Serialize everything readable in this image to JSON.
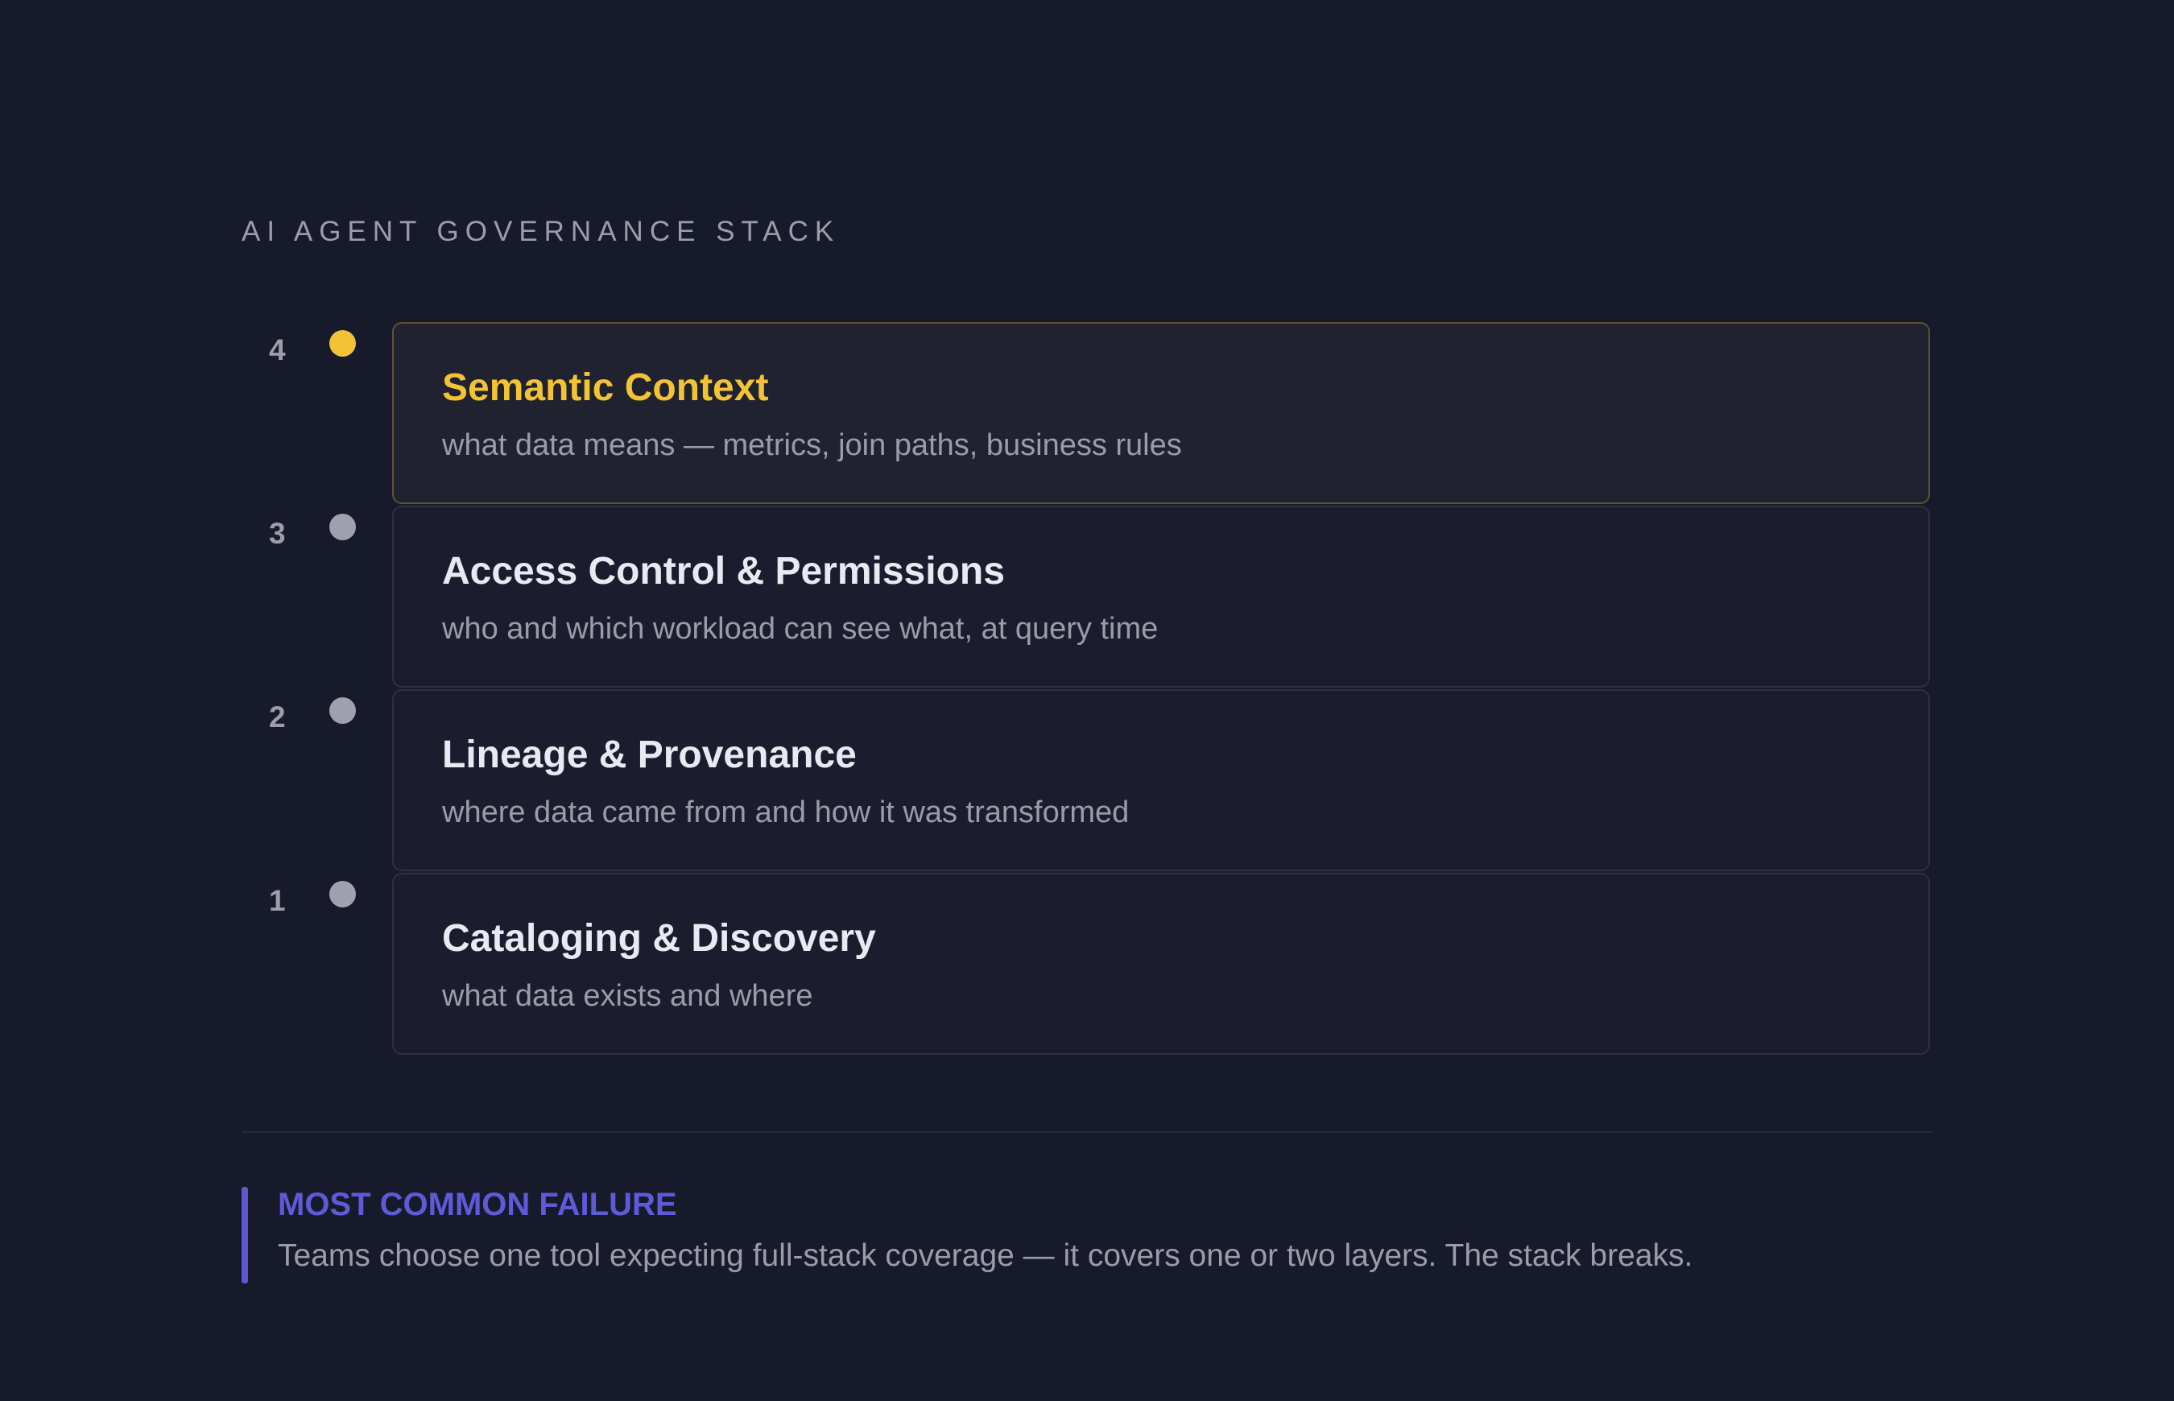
{
  "title": "AI AGENT GOVERNANCE STACK",
  "layers": [
    {
      "number": "4",
      "name": "Semantic Context",
      "description": "what data means — metrics, join paths, business rules",
      "highlighted": true
    },
    {
      "number": "3",
      "name": "Access Control & Permissions",
      "description": "who and which workload can see what, at query time",
      "highlighted": false
    },
    {
      "number": "2",
      "name": "Lineage & Provenance",
      "description": "where data came from and how it was transformed",
      "highlighted": false
    },
    {
      "number": "1",
      "name": "Cataloging & Discovery",
      "description": "what data exists and where",
      "highlighted": false
    }
  ],
  "callout": {
    "title": "MOST COMMON FAILURE",
    "text": "Teams choose one tool expecting full-stack coverage — it covers one or two layers. The stack breaks."
  },
  "colors": {
    "background": "#171a2b",
    "highlight": "#f2c335",
    "callout_accent": "#5f5ad8",
    "dot_default": "#a0a0ae"
  }
}
